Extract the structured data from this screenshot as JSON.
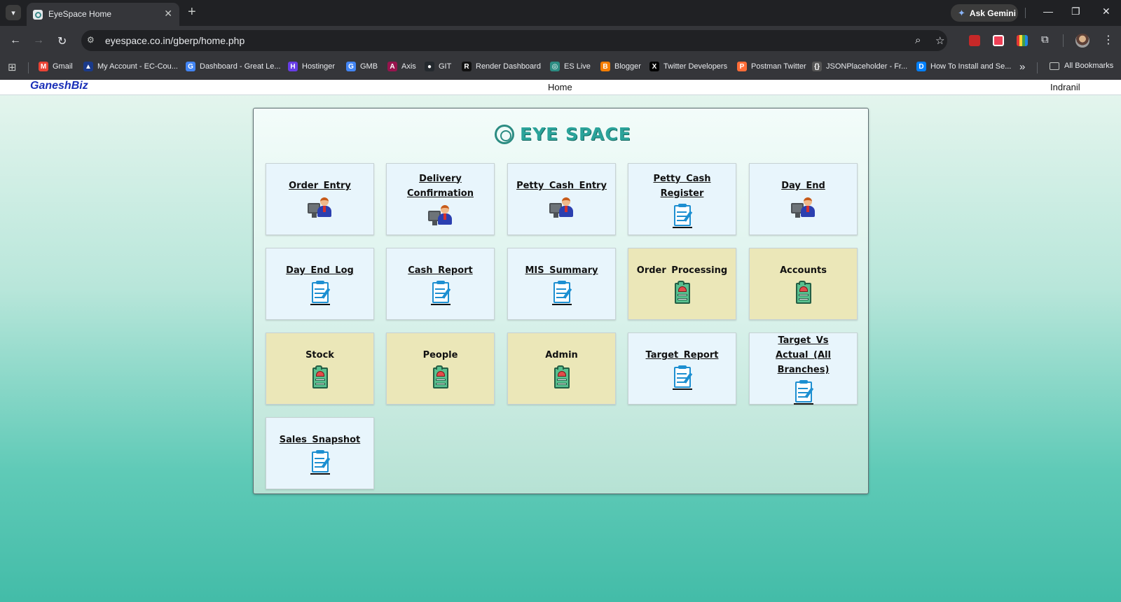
{
  "browser": {
    "tab_title": "EyeSpace Home",
    "url": "eyespace.co.in/gberp/home.php",
    "ask_gemini_label": "Ask Gemini",
    "bookmarks": [
      {
        "label": "Gmail",
        "icon": "gmail-icon",
        "color": "#ea4335",
        "glyph": "M"
      },
      {
        "label": "My Account - EC-Cou...",
        "icon": "account-icon",
        "color": "#1a3a8a",
        "glyph": "▲"
      },
      {
        "label": "Dashboard - Great Le...",
        "icon": "google-icon",
        "color": "#4285f4",
        "glyph": "G"
      },
      {
        "label": "Hostinger",
        "icon": "hostinger-icon",
        "color": "#673de6",
        "glyph": "H"
      },
      {
        "label": "GMB",
        "icon": "google-icon",
        "color": "#4285f4",
        "glyph": "G"
      },
      {
        "label": "Axis",
        "icon": "axis-icon",
        "color": "#97144d",
        "glyph": "A"
      },
      {
        "label": "GIT",
        "icon": "github-icon",
        "color": "#24292e",
        "glyph": "●"
      },
      {
        "label": "Render Dashboard",
        "icon": "render-icon",
        "color": "#111111",
        "glyph": "R"
      },
      {
        "label": "ES Live",
        "icon": "eyespace-icon",
        "color": "#2c8c82",
        "glyph": "◎"
      },
      {
        "label": "Blogger",
        "icon": "blogger-icon",
        "color": "#f57d00",
        "glyph": "B"
      },
      {
        "label": "Twitter Developers",
        "icon": "x-icon",
        "color": "#000000",
        "glyph": "X"
      },
      {
        "label": "Postman Twitter",
        "icon": "postman-icon",
        "color": "#ff6c37",
        "glyph": "P"
      },
      {
        "label": "JSONPlaceholder - Fr...",
        "icon": "json-icon",
        "color": "#555555",
        "glyph": "{}"
      },
      {
        "label": "How To Install and Se...",
        "icon": "digitalocean-icon",
        "color": "#0080ff",
        "glyph": "D"
      }
    ],
    "all_bookmarks_label": "All Bookmarks"
  },
  "topnav": {
    "logo": "GaneshBiz",
    "home": "Home",
    "user": "Indranil"
  },
  "brand": {
    "name": "EYE SPACE"
  },
  "tiles": [
    {
      "label": "Order Entry",
      "style": "blue",
      "icon": "person-computer-icon"
    },
    {
      "label": "Delivery Confirmation",
      "style": "blue",
      "icon": "person-computer-icon"
    },
    {
      "label": "Petty Cash Entry",
      "style": "blue",
      "icon": "person-computer-icon"
    },
    {
      "label": "Petty Cash Register",
      "style": "blue",
      "icon": "report-clipboard-icon"
    },
    {
      "label": "Day End",
      "style": "blue",
      "icon": "person-computer-icon"
    },
    {
      "label": "Day End Log",
      "style": "blue",
      "icon": "report-clipboard-icon"
    },
    {
      "label": "Cash Report",
      "style": "blue",
      "icon": "report-clipboard-icon"
    },
    {
      "label": "MIS Summary",
      "style": "blue",
      "icon": "report-clipboard-icon"
    },
    {
      "label": "Order Processing",
      "style": "tan",
      "icon": "green-folder-icon"
    },
    {
      "label": "Accounts",
      "style": "tan",
      "icon": "green-folder-icon"
    },
    {
      "label": "Stock",
      "style": "tan",
      "icon": "green-folder-icon"
    },
    {
      "label": "People",
      "style": "tan",
      "icon": "green-folder-icon"
    },
    {
      "label": "Admin",
      "style": "tan",
      "icon": "green-folder-icon"
    },
    {
      "label": "Target Report",
      "style": "blue",
      "icon": "report-clipboard-icon"
    },
    {
      "label": "Target Vs Actual (All Branches)",
      "style": "blue",
      "icon": "report-clipboard-icon"
    },
    {
      "label": "Sales Snapshot",
      "style": "blue",
      "icon": "report-clipboard-icon"
    }
  ],
  "colors": {
    "tile_blue": "#e8f5fc",
    "tile_tan": "#ebe7b8",
    "brand_teal": "#2ba39a"
  }
}
